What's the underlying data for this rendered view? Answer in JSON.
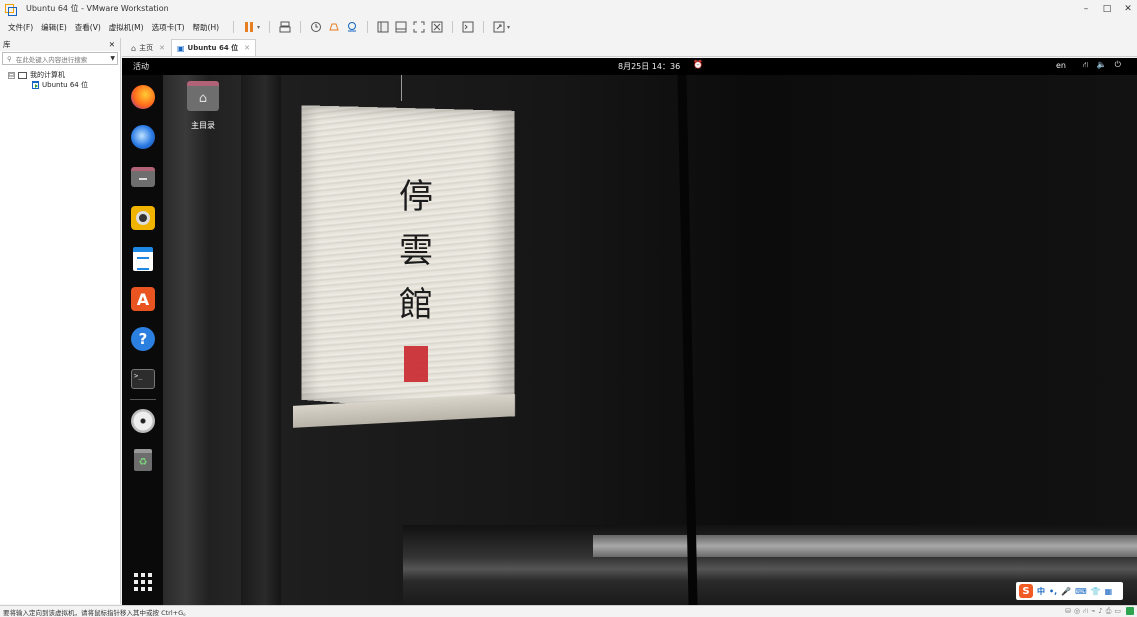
{
  "window": {
    "title": "Ubuntu 64 位 - VMware Workstation",
    "controls": {
      "minimize": "–",
      "maximize": "□",
      "close": "✕"
    }
  },
  "menubar": {
    "items": [
      "文件(F)",
      "编辑(E)",
      "查看(V)",
      "虚拟机(M)",
      "选项卡(T)",
      "帮助(H)"
    ]
  },
  "toolbar": {
    "icons": [
      "pause-icon",
      "send-ctrl-alt-del-icon",
      "snapshot-icon",
      "revert-snapshot-icon",
      "snapshot-manager-icon",
      "sidebar-view-icon",
      "thumbnail-view-icon",
      "fullscreen-icon",
      "unity-icon",
      "console-view-icon",
      "stretch-view-icon"
    ],
    "pause_color": "#e67e22"
  },
  "library": {
    "title": "库",
    "close": "✕",
    "search_placeholder": "在此处键入内容进行搜索",
    "tree": {
      "root_toggle": "⊟",
      "root_label": "我的计算机",
      "child_label": "Ubuntu 64 位"
    }
  },
  "tabs": [
    {
      "label": "主页",
      "icon": "home-icon",
      "close": "✕",
      "active": false
    },
    {
      "label": "Ubuntu 64 位",
      "icon": "vm-icon",
      "close": "✕",
      "active": true
    }
  ],
  "guest": {
    "topbar": {
      "activities": "活动",
      "clock": "8月25日 14：36",
      "alarm": "⏰",
      "input_lang": "en",
      "tray": [
        "⛙",
        "🔈",
        "⏻"
      ]
    },
    "dock": [
      "firefox-icon",
      "thunderbird-icon",
      "files-icon",
      "rhythmbox-icon",
      "libreoffice-writer-icon",
      "ubuntu-software-icon",
      "help-icon",
      "terminal-icon",
      "dvd-icon",
      "trash-icon",
      "show-apps-icon"
    ],
    "dock_labels": {
      "store": "A",
      "help": "?",
      "terminal": ">_",
      "trash": "♻"
    },
    "desktop_icon": {
      "label": "主目录",
      "glyph": "⌂"
    },
    "lantern_text": [
      "停",
      "雲",
      "館"
    ],
    "ime": {
      "logo": "S",
      "items": [
        "中",
        "•,",
        "🎤",
        "⌨",
        "👕",
        "▦"
      ]
    }
  },
  "statusbar": {
    "text": "要将输入定向到该虚拟机，请将鼠标指针移入其中或按 Ctrl+G。",
    "icons": [
      "hdd-icon",
      "cd-icon",
      "network-icon",
      "usb-icon",
      "sound-icon",
      "printer-icon",
      "display-icon"
    ],
    "accent": "#2ea44f"
  }
}
